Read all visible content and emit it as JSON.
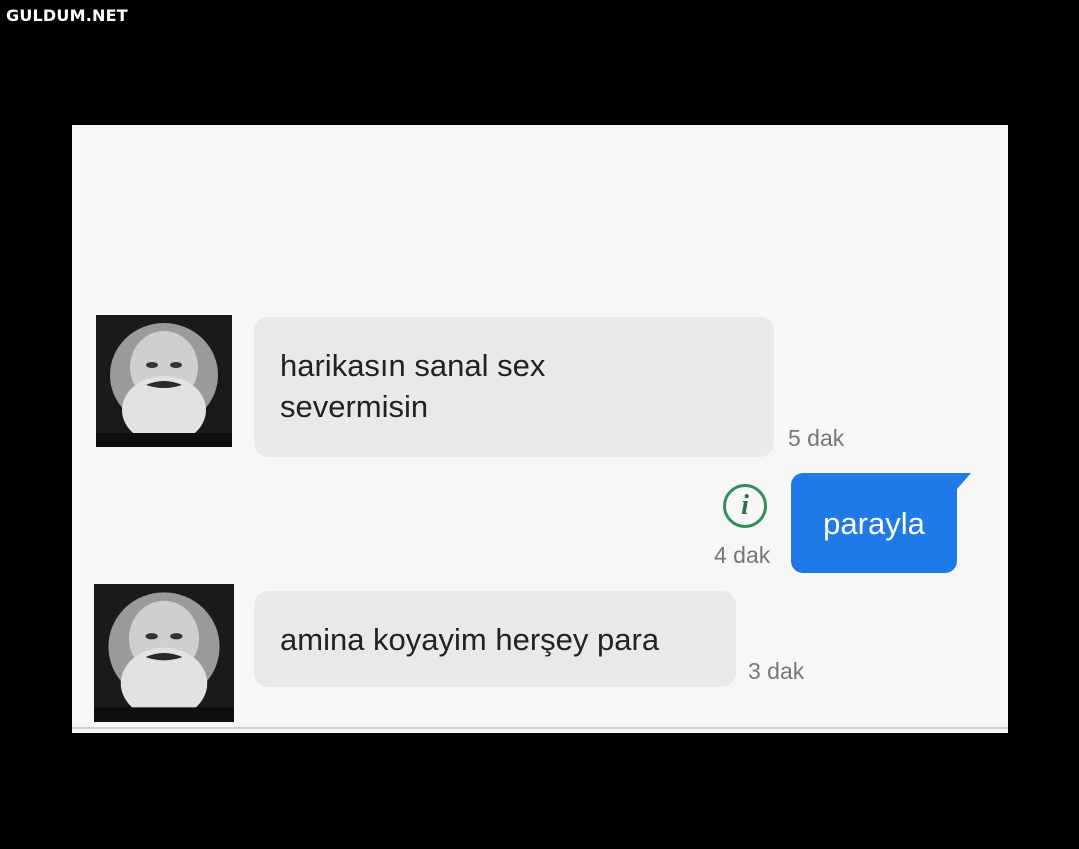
{
  "watermark": "GULDUM.NET",
  "messages": [
    {
      "text": "harikasın sanal sex severmisin",
      "time": "5 dak",
      "sender": "contact"
    },
    {
      "text": "parayla",
      "time": "4 dak",
      "sender": "me"
    },
    {
      "text": "amina koyayim herşey para",
      "time": "3 dak",
      "sender": "contact"
    }
  ],
  "icons": {
    "info": "info-icon"
  },
  "colors": {
    "outgoing_bubble": "#1f7ae8",
    "incoming_bubble": "#e9e9e9",
    "info_icon": "#2d8f5b"
  }
}
